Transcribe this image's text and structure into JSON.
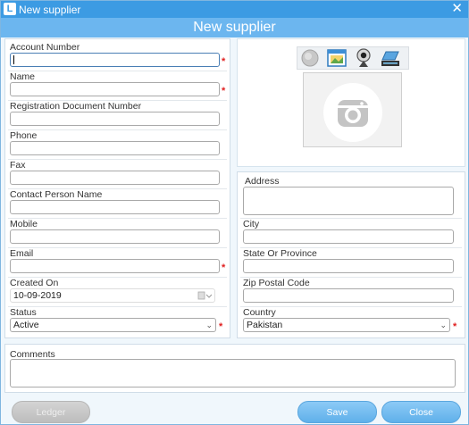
{
  "window": {
    "title": "New supplier",
    "close_glyph": "✕"
  },
  "header": {
    "title": "New supplier"
  },
  "form": {
    "account_number": {
      "label": "Account Number",
      "value": ""
    },
    "name": {
      "label": "Name",
      "value": ""
    },
    "registration_document_number": {
      "label": "Registration Document Number",
      "value": ""
    },
    "phone": {
      "label": "Phone",
      "value": ""
    },
    "fax": {
      "label": "Fax",
      "value": ""
    },
    "contact_person_name": {
      "label": "Contact Person Name",
      "value": ""
    },
    "mobile": {
      "label": "Mobile",
      "value": ""
    },
    "email": {
      "label": "Email",
      "value": ""
    },
    "created_on": {
      "label": "Created On",
      "value": "10-09-2019"
    },
    "status": {
      "label": "Status",
      "value": "Active"
    },
    "address": {
      "label": "Address",
      "value": ""
    },
    "city": {
      "label": "City",
      "value": ""
    },
    "state_or_province": {
      "label": "State Or Province",
      "value": ""
    },
    "zip_postal_code": {
      "label": "Zip Postal Code",
      "value": ""
    },
    "country": {
      "label": "Country",
      "value": "Pakistan"
    },
    "comments": {
      "label": "Comments",
      "value": ""
    }
  },
  "required_marker": "*",
  "photo_tools": [
    {
      "icon": "globe-icon"
    },
    {
      "icon": "image-file-icon"
    },
    {
      "icon": "webcam-icon"
    },
    {
      "icon": "scanner-icon"
    }
  ],
  "photo_placeholder_icon": "camera-icon",
  "buttons": {
    "ledger": "Ledger",
    "save": "Save",
    "close": "Close"
  },
  "colors": {
    "titlebar": "#3c9be3",
    "header": "#6cb6ef",
    "button_blue": "#5fb0ea",
    "button_disabled": "#bdbdbd",
    "required": "#e02020"
  }
}
